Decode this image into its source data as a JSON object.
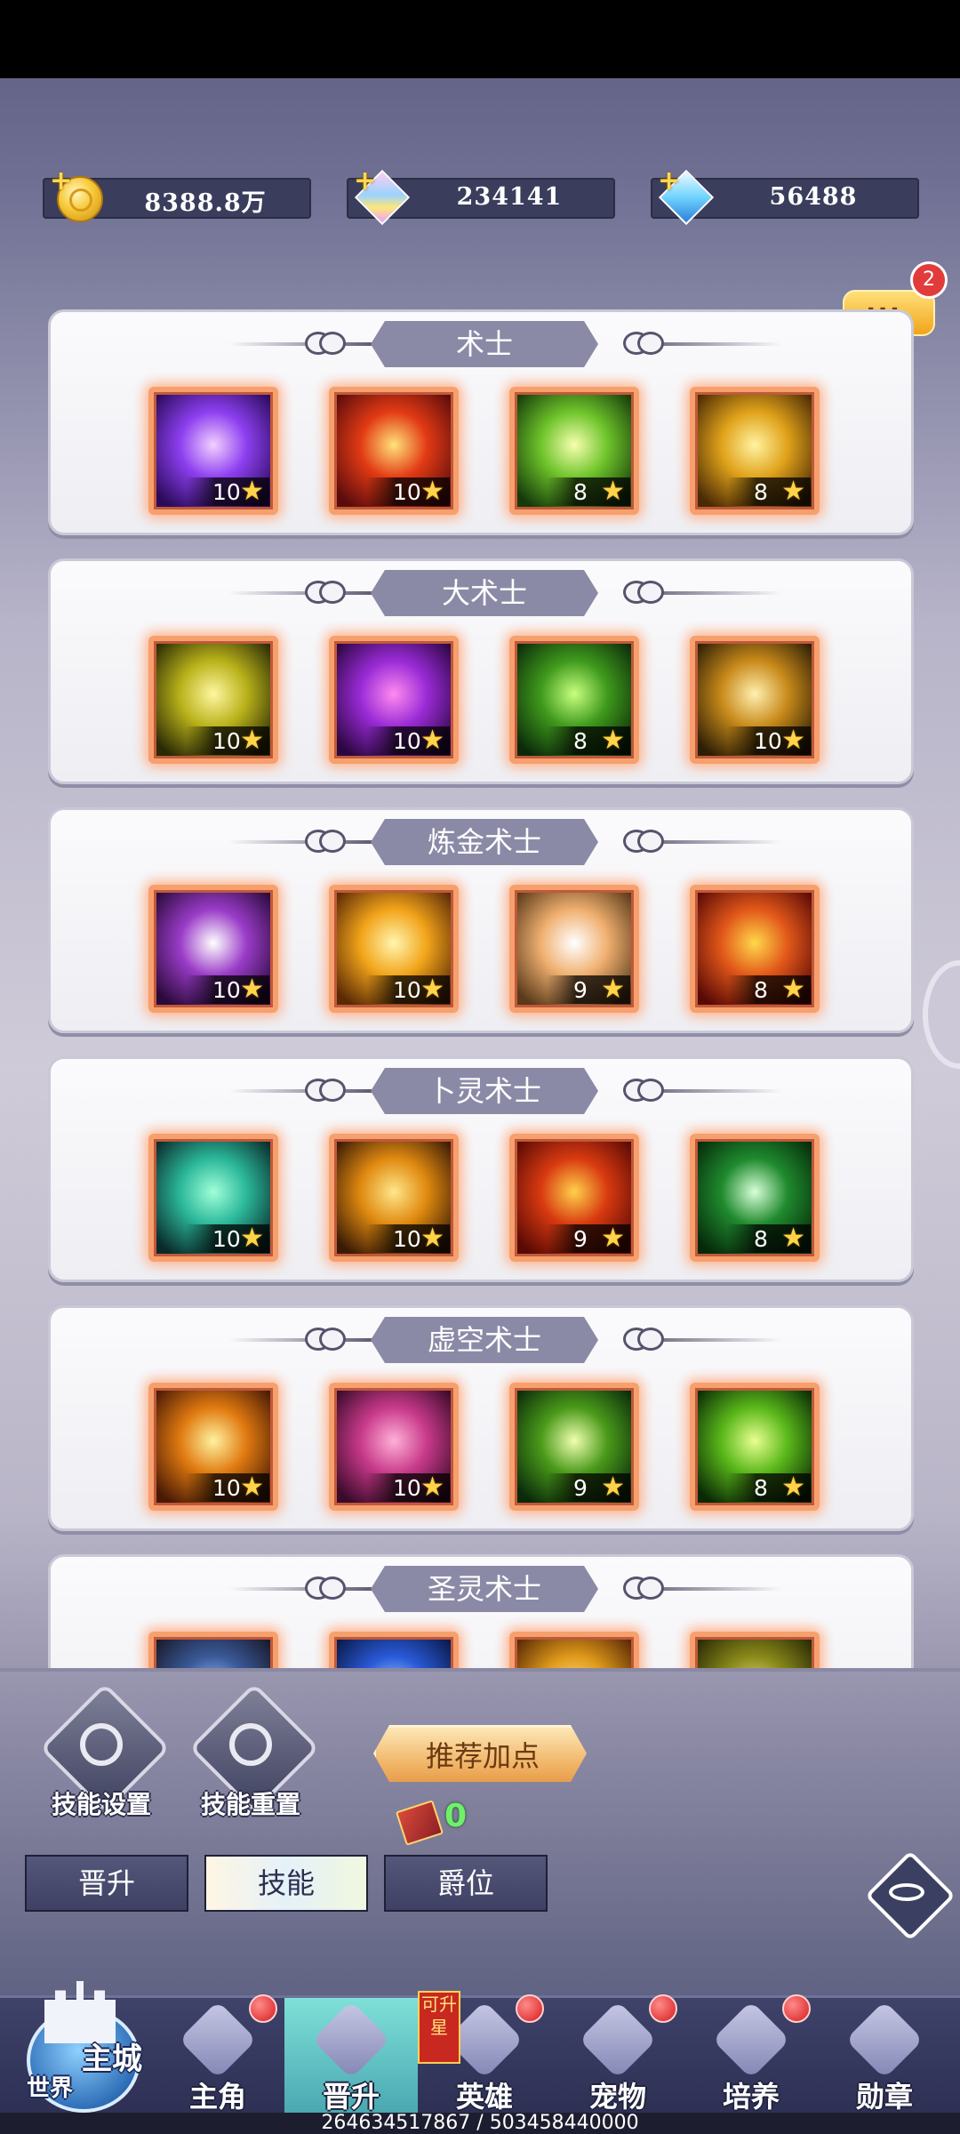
{
  "resources": [
    {
      "icon": "gold-coin-icon",
      "value": "8388.8万"
    },
    {
      "icon": "rainbow-gem-icon",
      "value": "234141"
    },
    {
      "icon": "diamond-icon",
      "value": "56488"
    }
  ],
  "chat": {
    "badge": "2",
    "dots": "···"
  },
  "classes": [
    {
      "title": "术士",
      "skills": [
        {
          "level": "10",
          "colors": [
            "#2a0b5a",
            "#8d3ff0",
            "#f2d0ff"
          ]
        },
        {
          "level": "10",
          "colors": [
            "#5a0c0c",
            "#e23a14",
            "#ffe27a"
          ]
        },
        {
          "level": "8",
          "colors": [
            "#153a0a",
            "#6fc42b",
            "#f6ffb0"
          ]
        },
        {
          "level": "8",
          "colors": [
            "#4a2a05",
            "#e0a21a",
            "#fff3a0"
          ]
        }
      ]
    },
    {
      "title": "大术士",
      "skills": [
        {
          "level": "10",
          "colors": [
            "#2a2a05",
            "#b9b21a",
            "#fff7a0"
          ]
        },
        {
          "level": "10",
          "colors": [
            "#2b0640",
            "#9a2bd6",
            "#ff8af0"
          ]
        },
        {
          "level": "8",
          "colors": [
            "#0b2a0a",
            "#3f9a1c",
            "#c8ff80"
          ]
        },
        {
          "level": "10",
          "colors": [
            "#2e1e05",
            "#c88a1a",
            "#fff0b0"
          ]
        }
      ]
    },
    {
      "title": "炼金术士",
      "skills": [
        {
          "level": "10",
          "colors": [
            "#2a0a3a",
            "#9a3cc8",
            "#ffffff"
          ]
        },
        {
          "level": "10",
          "colors": [
            "#5a2a05",
            "#f2a41a",
            "#fff6b0"
          ]
        },
        {
          "level": "9",
          "colors": [
            "#5a3a1a",
            "#f0b070",
            "#ffffff"
          ]
        },
        {
          "level": "8",
          "colors": [
            "#5a0a05",
            "#e2581a",
            "#ffd84a"
          ]
        }
      ]
    },
    {
      "title": "卜灵术士",
      "skills": [
        {
          "level": "10",
          "colors": [
            "#0a2a2a",
            "#2bb89a",
            "#a0ffd8"
          ]
        },
        {
          "level": "10",
          "colors": [
            "#3a1a05",
            "#e08a10",
            "#ffe68a"
          ]
        },
        {
          "level": "9",
          "colors": [
            "#5a0a05",
            "#d83a10",
            "#ffd04a"
          ]
        },
        {
          "level": "8",
          "colors": [
            "#052a0a",
            "#1f8a2e",
            "#d8ffd8"
          ]
        }
      ]
    },
    {
      "title": "虚空术士",
      "skills": [
        {
          "level": "10",
          "colors": [
            "#4a1a05",
            "#e07a10",
            "#fff2a0"
          ]
        },
        {
          "level": "10",
          "colors": [
            "#3a0a2a",
            "#c83a8a",
            "#ffb0d8"
          ]
        },
        {
          "level": "9",
          "colors": [
            "#0a2a0a",
            "#4a9a1a",
            "#f0ffb0"
          ]
        },
        {
          "level": "8",
          "colors": [
            "#0a2a05",
            "#5ab81a",
            "#e8ff90"
          ]
        }
      ]
    },
    {
      "title": "圣灵术士",
      "skills": [
        {
          "level": "",
          "colors": [
            "#1a1a2a",
            "#3a5a9a",
            "#a0c0ff"
          ]
        },
        {
          "level": "",
          "colors": [
            "#0a1a4a",
            "#2a5ad8",
            "#a0d0ff"
          ]
        },
        {
          "level": "",
          "colors": [
            "#5a2a05",
            "#e09a1a",
            "#ffe08a"
          ]
        },
        {
          "level": "",
          "colors": [
            "#2a2a05",
            "#8a8a1a",
            "#e0e08a"
          ]
        }
      ]
    }
  ],
  "actions": {
    "skill_settings": "技能设置",
    "skill_reset": "技能重置",
    "recommend": "推荐加点",
    "book_count": "0"
  },
  "tabs": [
    "晋升",
    "技能",
    "爵位"
  ],
  "active_tab": "技能",
  "nav": {
    "castle_main": "主城",
    "castle_world": "世界",
    "items": [
      {
        "label": "主角",
        "dot": true
      },
      {
        "label": "晋升",
        "dot": false,
        "active": true
      },
      {
        "label": "英雄",
        "dot": true,
        "tag": "可升星"
      },
      {
        "label": "宠物",
        "dot": true
      },
      {
        "label": "培养",
        "dot": true
      },
      {
        "label": "勋章",
        "dot": false
      }
    ]
  },
  "footer_text": "264634517867 / 503458440000",
  "accent": {
    "panel_title": "#8b8aa6",
    "skill_border": "#f6a06e",
    "badge": "#e23b3b"
  }
}
